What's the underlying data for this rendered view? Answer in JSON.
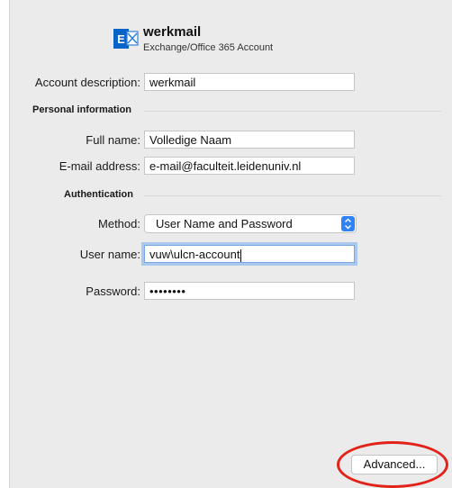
{
  "account": {
    "name": "werkmail",
    "type": "Exchange/Office 365 Account",
    "icon": "exchange-icon",
    "icon_letter": "E",
    "brand_color": "#0a64c8"
  },
  "form": {
    "description_label": "Account description:",
    "description_value": "werkmail",
    "personal_section": "Personal information",
    "fullname_label": "Full name:",
    "fullname_value": "Volledige Naam",
    "email_label": "E-mail address:",
    "email_value": "e-mail@faculteit.leidenuniv.nl",
    "auth_section": "Authentication",
    "method_label": "Method:",
    "method_value": "User Name and Password",
    "username_label": "User name:",
    "username_value": "vuw\\ulcn-account",
    "password_label": "Password:",
    "password_value": "••••••••"
  },
  "actions": {
    "advanced_label": "Advanced..."
  },
  "colors": {
    "accent": "#2f83f7",
    "highlight": "#e2231a",
    "panel_bg": "#ebebeb"
  }
}
